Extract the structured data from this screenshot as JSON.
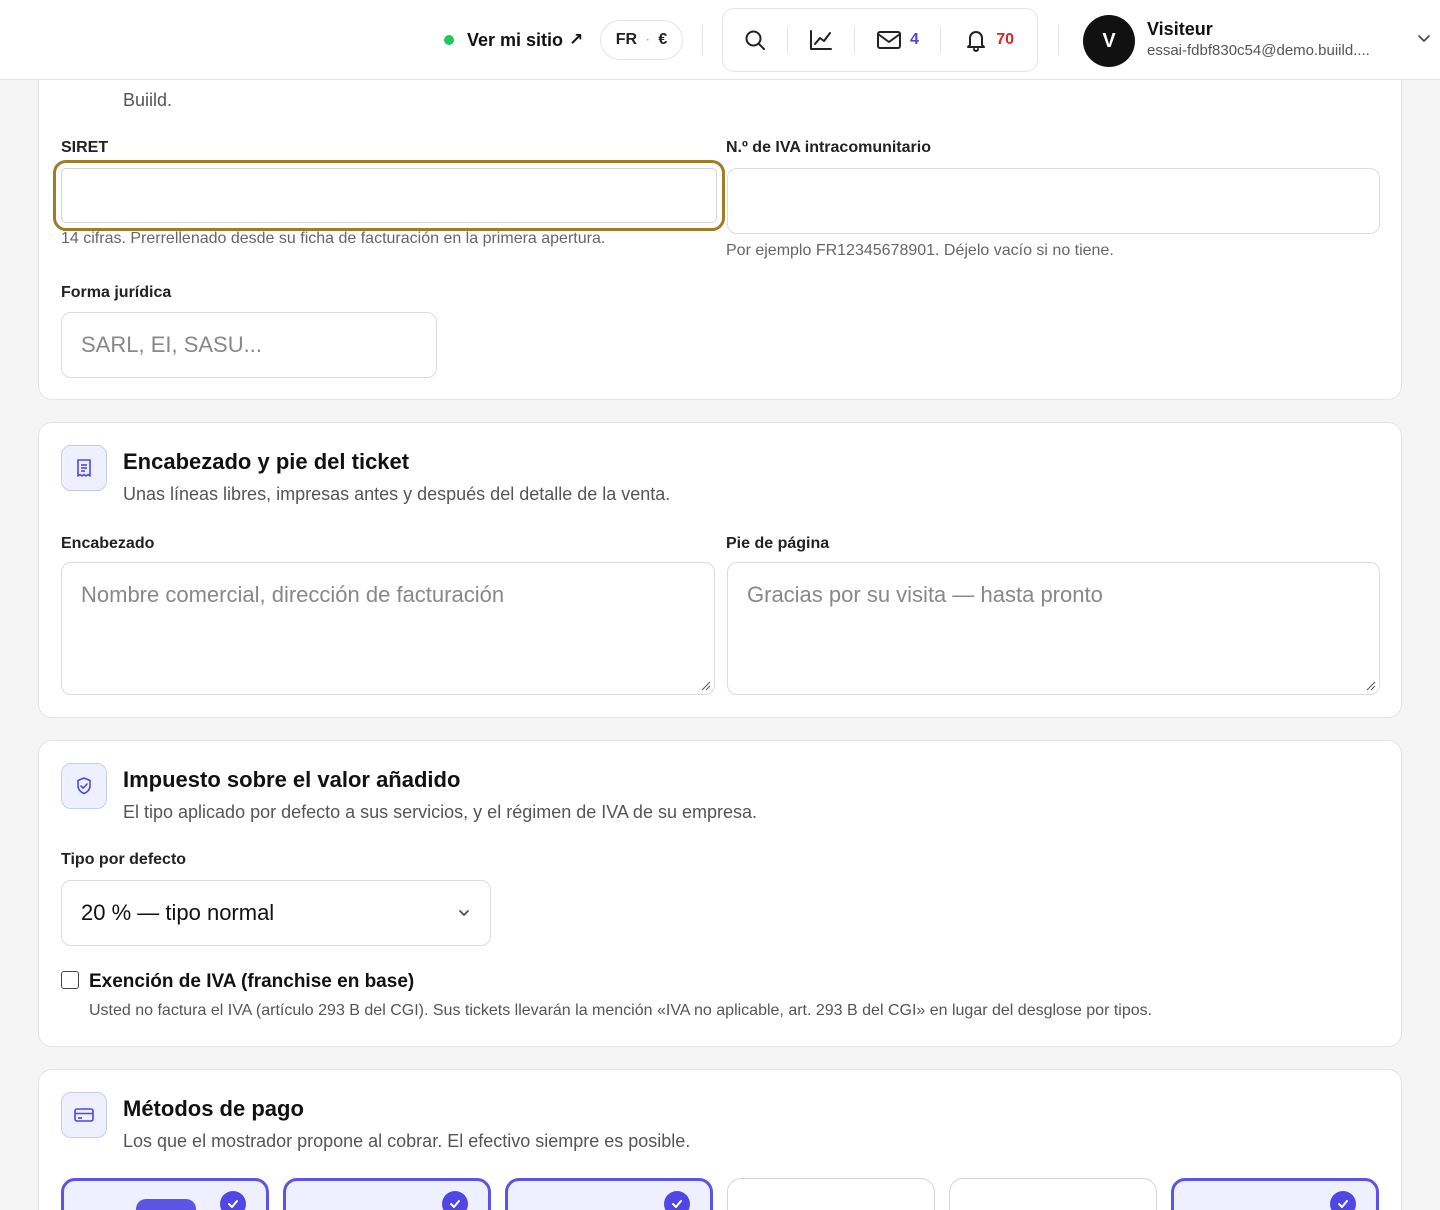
{
  "topbar": {
    "site_link": "Ver mi sitio",
    "site_arrow": "↗",
    "locale_lang": "FR",
    "locale_sep": "·",
    "locale_currency": "€",
    "messages_count": "4",
    "notifications_count": "70",
    "user_initial": "V",
    "user_name": "Visiteur",
    "user_email": "essai-fdbf830c54@demo.buiild...."
  },
  "company_card": {
    "prev_text": "Buiild.",
    "siret_label": "SIRET",
    "siret_value": "",
    "siret_hint": "14 cifras. Prerrellenado desde su ficha de facturación en la primera apertura.",
    "vat_label": "N.º de IVA intracomunitario",
    "vat_value": "",
    "vat_hint": "Por ejemplo FR12345678901. Déjelo vacío si no tiene.",
    "legal_label": "Forma jurídica",
    "legal_placeholder": "SARL, EI, SASU..."
  },
  "ticket_card": {
    "icon": "receipt-icon",
    "title": "Encabezado y pie del ticket",
    "subtitle": "Unas líneas libres, impresas antes y después del detalle de la venta.",
    "header_label": "Encabezado",
    "header_placeholder": "Nombre comercial, dirección de facturación",
    "footer_label": "Pie de página",
    "footer_placeholder": "Gracias por su visita — hasta pronto"
  },
  "vat_card": {
    "icon": "shield-check-icon",
    "title": "Impuesto sobre el valor añadido",
    "subtitle": "El tipo aplicado por defecto a sus servicios, y el régimen de IVA de su empresa.",
    "rate_label": "Tipo por defecto",
    "rate_selected": "20 % — tipo normal",
    "exemption_label": "Exención de IVA (franchise en base)",
    "exemption_checked": false,
    "exemption_hint": "Usted no factura el IVA (artículo 293 B del CGI). Sus tickets llevarán la mención «IVA no aplicable, art. 293 B del CGI» en lugar del desglose por tipos."
  },
  "payment_card": {
    "icon": "credit-card-icon",
    "title": "Métodos de pago",
    "subtitle": "Los que el mostrador propone al cobrar. El efectivo siempre es posible.",
    "methods_selected": [
      true,
      true,
      true,
      false,
      false,
      true
    ]
  },
  "colors": {
    "accent": "#4f46e5",
    "focus_ring": "#a17a2a",
    "online_dot": "#22c55e",
    "notification_red": "#dc2626"
  }
}
